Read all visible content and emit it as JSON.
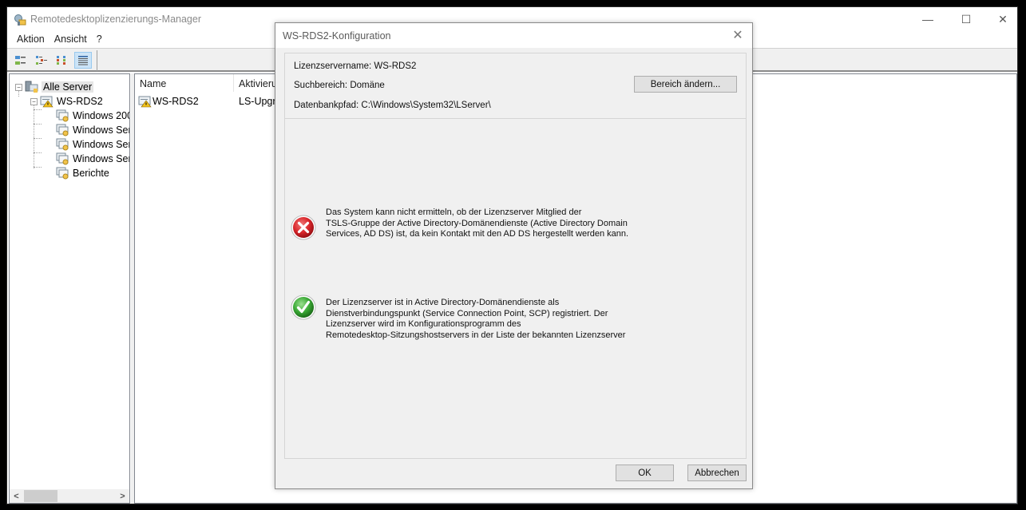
{
  "window": {
    "title": "Remotedesktoplizenzierungs-Manager",
    "controls": {
      "minimize": "—",
      "maximize": "☐",
      "close": "✕"
    }
  },
  "menubar": {
    "items": [
      {
        "label": "Aktion"
      },
      {
        "label": "Ansicht"
      },
      {
        "label": "?"
      }
    ]
  },
  "toolbar": {
    "buttons": [
      {
        "icon": "tree-view-icon"
      },
      {
        "icon": "list-view-small-icon"
      },
      {
        "icon": "list-view-large-icon"
      },
      {
        "icon": "details-view-icon",
        "active": true
      }
    ]
  },
  "tree": {
    "root": {
      "label": "Alle Server",
      "expander": "−"
    },
    "server": {
      "label": "WS-RDS2",
      "expander": "−",
      "status": "warning"
    },
    "children": [
      {
        "label": "Windows 200"
      },
      {
        "label": "Windows Ser"
      },
      {
        "label": "Windows Ser"
      },
      {
        "label": "Windows Ser"
      },
      {
        "label": "Berichte"
      }
    ],
    "scroll_left": "<",
    "scroll_right": ">"
  },
  "list": {
    "columns": [
      {
        "label": "Name"
      },
      {
        "label": "Aktivieru"
      }
    ],
    "rows": [
      {
        "name": "WS-RDS2",
        "activation": "LS-Upgra"
      }
    ]
  },
  "dialog": {
    "title": "WS-RDS2-Konfiguration",
    "close": "✕",
    "server_name_line": "Lizenzservername: WS-RDS2",
    "scope_line": "Suchbereich: Domäne",
    "db_path_line": "Datenbankpfad: C:\\Windows\\System32\\LServer\\",
    "change_scope_button": "Bereich ändern...",
    "statuses": [
      {
        "type": "error",
        "color": "#d9262b",
        "lines": [
          "Das System kann nicht ermitteln, ob der Lizenzserver Mitglied der",
          "TSLS-Gruppe der Active Directory-Domänendienste (Active Directory Domain",
          "Services, AD DS) ist, da kein Kontakt mit den AD DS hergestellt werden kann."
        ]
      },
      {
        "type": "ok",
        "color": "#3aa835",
        "lines": [
          "Der Lizenzserver ist in Active Directory-Domänendienste als",
          "Dienstverbindungspunkt (Service Connection Point, SCP) registriert. Der",
          "Lizenzserver wird im Konfigurationsprogramm des",
          "Remotedesktop-Sitzungshostservers in der Liste der bekannten Lizenzserver"
        ]
      }
    ],
    "ok_button": "OK",
    "cancel_button": "Abbrechen"
  }
}
